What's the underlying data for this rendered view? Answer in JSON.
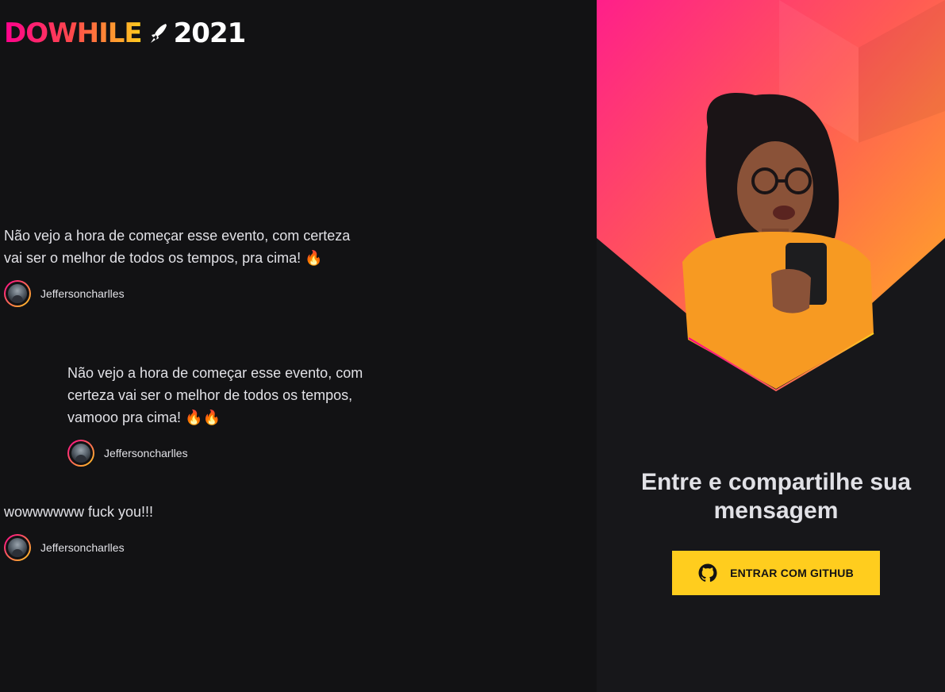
{
  "logo": {
    "brand": "DOWHILE",
    "year": "2021"
  },
  "messages": [
    {
      "text": "Não vejo a hora de começar esse evento, com certeza vai ser o melhor de todos os tempos, pra cima! 🔥",
      "username": "Jeffersoncharlles"
    },
    {
      "text": "Não vejo a hora de começar esse evento, com certeza vai ser o melhor de todos os tempos, vamooo pra cima! 🔥🔥",
      "username": "Jeffersoncharlles"
    },
    {
      "text": "wowwwwww fuck you!!!",
      "username": "Jeffersoncharlles"
    }
  ],
  "signin": {
    "title": "Entre e compartilhe sua mensagem",
    "button_label": "ENTRAR COM GITHUB"
  },
  "colors": {
    "background": "#121214",
    "accent_pink": "#ff008e",
    "accent_yellow": "#ffcd1e",
    "text": "#e1e1e6"
  },
  "icons": [
    "rocket-icon",
    "github-icon",
    "fire-emoji"
  ]
}
